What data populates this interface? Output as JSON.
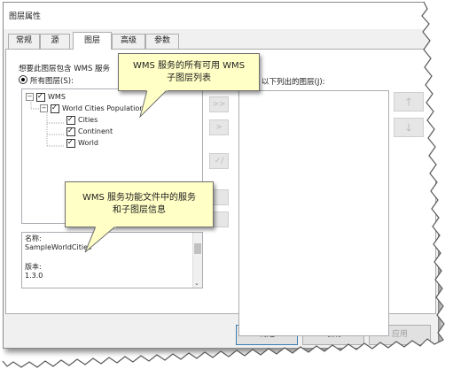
{
  "dialog": {
    "title": "图层属性"
  },
  "tabs": [
    {
      "label": "常规",
      "active": false
    },
    {
      "label": "源",
      "active": false
    },
    {
      "label": "图层",
      "active": true
    },
    {
      "label": "高级",
      "active": false
    },
    {
      "label": "参数",
      "active": false
    }
  ],
  "layers_panel": {
    "prompt": "想要此图层包含 WMS 服务",
    "all_layers_label": "所有图层(S):",
    "listed_layers_label": "以下列出的图层(J):",
    "tree": {
      "root": "WMS",
      "group": "World Cities Population",
      "children": [
        "Cities",
        "Continent",
        "World"
      ]
    },
    "middle_buttons": [
      ">>",
      ">",
      "✓/"
    ]
  },
  "info": {
    "name_label": "名称:",
    "name_value": "SampleWorldCities",
    "version_label": "版本:",
    "version_value": "1.3.0"
  },
  "buttons": {
    "ok": "确定",
    "cancel": "取消",
    "apply": "应用"
  },
  "callouts": {
    "top_line1": "WMS 服务的所有可用 WMS",
    "top_line2": "子图层列表",
    "bottom_line1": "WMS 服务功能文件中的服务",
    "bottom_line2": "和子图层信息"
  },
  "icons": {
    "move_up": "arrow-up-icon",
    "move_down": "arrow-down-icon"
  },
  "colors": {
    "callout_fill": "#ffffc6",
    "dialog_bg": "#f0f0f0",
    "ok_border": "#3c7fb1"
  }
}
